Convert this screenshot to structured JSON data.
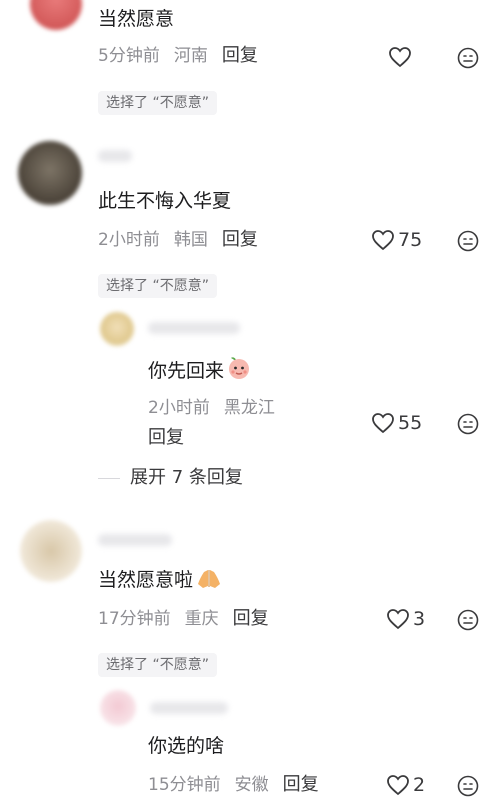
{
  "comments": [
    {
      "content": "当然愿意",
      "time": "5分钟前",
      "location": "河南",
      "reply": "回复",
      "tag": "选择了 “不愿意”"
    },
    {
      "content": "此生不悔入华夏",
      "time": "2小时前",
      "location": "韩国",
      "reply": "回复",
      "likes": "75",
      "tag": "选择了 “不愿意”",
      "sub": {
        "content": "你先回来",
        "time": "2小时前",
        "location": "黑龙江",
        "reply": "回复",
        "likes": "55"
      },
      "expand": "展开 7 条回复"
    },
    {
      "content": "当然愿意啦",
      "time": "17分钟前",
      "location": "重庆",
      "reply": "回复",
      "likes": "3",
      "tag": "选择了 “不愿意”",
      "sub": {
        "content": "你选的啥",
        "time": "15分钟前",
        "location": "安徽",
        "reply": "回复",
        "likes": "2"
      }
    }
  ],
  "icons": {
    "like": "heart-outline-icon",
    "react": "smile-face-icon",
    "peach": "peach-emoji",
    "pray": "praying-hands-emoji"
  },
  "colors": {
    "meta": "#8e8e93",
    "text": "#1c1c1e",
    "tag_bg": "#f4f4f6"
  }
}
